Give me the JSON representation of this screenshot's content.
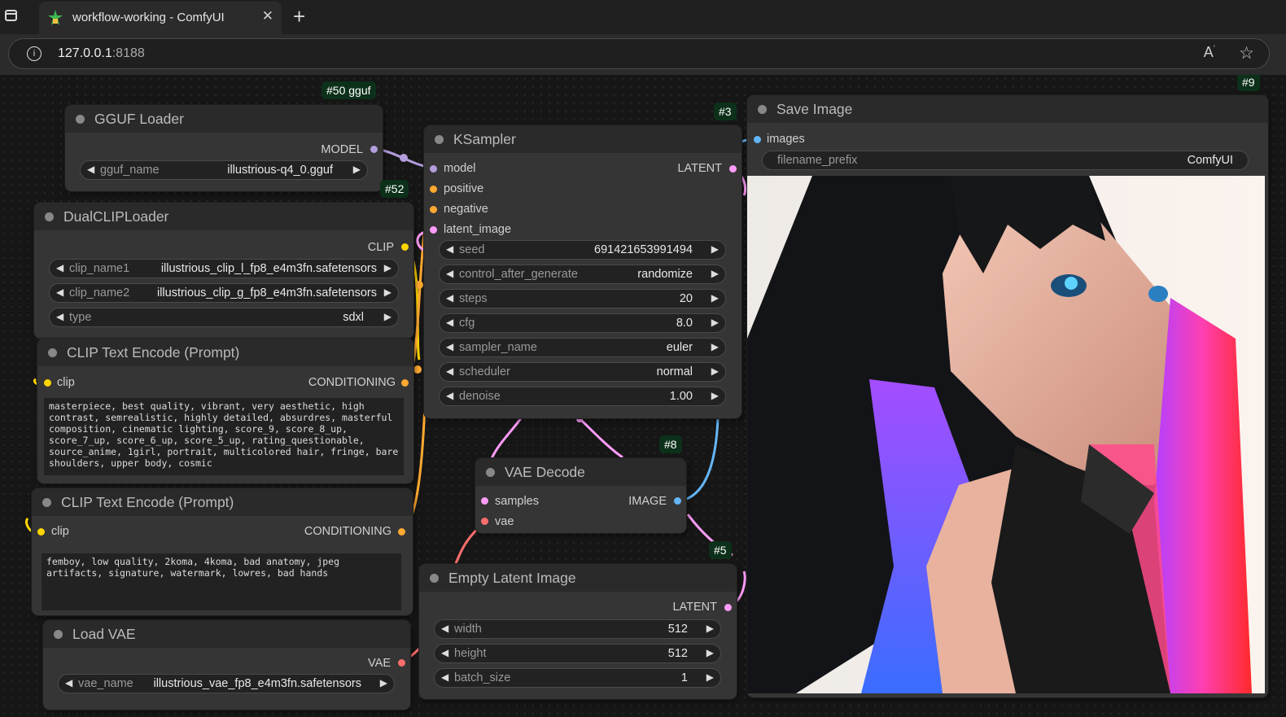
{
  "browser": {
    "tab_title": "workflow-working - ComfyUI",
    "url_host": "127.0.0.1",
    "url_port": ":8188"
  },
  "nodes": {
    "gguf_loader": {
      "badge": "#50 gguf",
      "title": "GGUF Loader",
      "output": "MODEL",
      "widgets": [
        {
          "name": "gguf_name",
          "value": "illustrious-q4_0.gguf"
        }
      ]
    },
    "dual_clip": {
      "badge": "#52",
      "title": "DualCLIPLoader",
      "output": "CLIP",
      "widgets": [
        {
          "name": "clip_name1",
          "value": "illustrious_clip_l_fp8_e4m3fn.safetensors"
        },
        {
          "name": "clip_name2",
          "value": "illustrious_clip_g_fp8_e4m3fn.safetensors"
        },
        {
          "name": "type",
          "value": "sdxl"
        }
      ]
    },
    "clip_pos": {
      "title": "CLIP Text Encode (Prompt)",
      "input": "clip",
      "output": "CONDITIONING",
      "text": "masterpiece, best quality, vibrant, very aesthetic, high contrast, semrealistic, highly detailed, absurdres, masterful composition, cinematic lighting, score_9, score_8_up, score_7_up, score_6_up, score_5_up, rating_questionable, source_anime, 1girl, portrait, multicolored hair, fringe, bare shoulders, upper body, cosmic"
    },
    "clip_neg": {
      "title": "CLIP Text Encode (Prompt)",
      "input": "clip",
      "output": "CONDITIONING",
      "text": "femboy, low quality, 2koma, 4koma, bad anatomy, jpeg artifacts, signature, watermark, lowres, bad hands"
    },
    "load_vae": {
      "title": "Load VAE",
      "output": "VAE",
      "widgets": [
        {
          "name": "vae_name",
          "value": "illustrious_vae_fp8_e4m3fn.safetensors"
        }
      ]
    },
    "ksampler": {
      "badge": "#3",
      "title": "KSampler",
      "output": "LATENT",
      "inputs": [
        "model",
        "positive",
        "negative",
        "latent_image"
      ],
      "widgets": [
        {
          "name": "seed",
          "value": "691421653991494"
        },
        {
          "name": "control_after_generate",
          "value": "randomize"
        },
        {
          "name": "steps",
          "value": "20"
        },
        {
          "name": "cfg",
          "value": "8.0"
        },
        {
          "name": "sampler_name",
          "value": "euler"
        },
        {
          "name": "scheduler",
          "value": "normal"
        },
        {
          "name": "denoise",
          "value": "1.00"
        }
      ]
    },
    "vae_decode": {
      "badge": "#8",
      "title": "VAE Decode",
      "output": "IMAGE",
      "inputs": [
        "samples",
        "vae"
      ]
    },
    "empty_latent": {
      "badge": "#5",
      "title": "Empty Latent Image",
      "output": "LATENT",
      "widgets": [
        {
          "name": "width",
          "value": "512"
        },
        {
          "name": "height",
          "value": "512"
        },
        {
          "name": "batch_size",
          "value": "1"
        }
      ]
    },
    "save_image": {
      "badge": "#9",
      "title": "Save Image",
      "input": "images",
      "widgets": [
        {
          "name": "filename_prefix",
          "value": "ComfyUI"
        }
      ]
    }
  },
  "colors": {
    "model": "#b39ddb",
    "clip": "#ffd500",
    "conditioning": "#ffa931",
    "latent": "#ff9cf9",
    "vae": "#ff6e6e",
    "image": "#64b5f6"
  }
}
